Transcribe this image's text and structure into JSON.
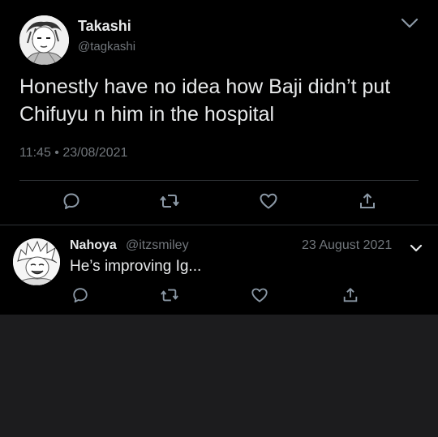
{
  "colors": {
    "background": "#000000",
    "empty_area": "#1c1c1e",
    "text_primary": "#e7e9ea",
    "text_secondary": "#71767b",
    "divider": "#2f3336"
  },
  "main_tweet": {
    "author_name": "Takashi",
    "author_handle": "@tagkashi",
    "text": "Honestly have no idea how Baji didn’t put Chifuyu n him in the hospital",
    "timestamp": "11:45 • 23/08/2021",
    "actions": [
      "reply-icon",
      "retweet-icon",
      "like-icon",
      "share-icon"
    ]
  },
  "reply_tweet": {
    "author_name": "Nahoya",
    "author_handle": "@itzsmiley",
    "date": "23 August 2021",
    "text": "He’s improving Ig...",
    "actions": [
      "reply-icon",
      "retweet-icon",
      "like-icon",
      "share-icon"
    ]
  }
}
